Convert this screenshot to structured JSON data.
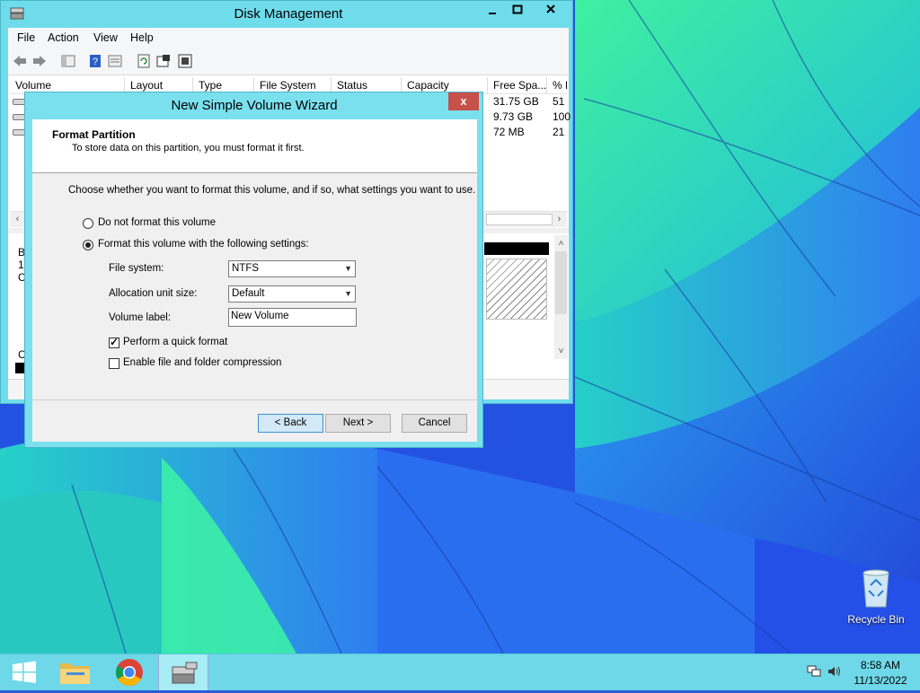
{
  "colors": {
    "window_frame": "#6fdcec",
    "close_button": "#c7504a",
    "taskbar": "#6fd8e8",
    "default_button_border": "#3c8fd9"
  },
  "disk_management": {
    "title": "Disk Management",
    "menu": [
      "File",
      "Action",
      "View",
      "Help"
    ],
    "toolbar_icons": [
      "back-arrow-icon",
      "forward-arrow-icon",
      "console-tree-icon",
      "help-icon",
      "properties-icon",
      "refresh-icon",
      "settings-icon",
      "rescan-icon"
    ],
    "columns": [
      "Volume",
      "Layout",
      "Type",
      "File System",
      "Status",
      "Capacity",
      "Free Spa...",
      "% F"
    ],
    "rows": [
      {
        "free": "31.75 GB",
        "pct": "51"
      },
      {
        "free": "9.73 GB",
        "pct": "100"
      },
      {
        "free": "72 MB",
        "pct": "21"
      }
    ],
    "disk_pane_letters": [
      "B",
      "1",
      "C",
      "C"
    ]
  },
  "wizard": {
    "title": "New Simple Volume Wizard",
    "close_glyph": "x",
    "step_title": "Format Partition",
    "step_desc": "To store data on this partition, you must format it first.",
    "instruction": "Choose whether you want to format this volume, and if so, what settings you want to use.",
    "radio_no_format": "Do not format this volume",
    "radio_format": "Format this volume with the following settings:",
    "file_system_label": "File system:",
    "file_system_value": "NTFS",
    "alloc_label": "Allocation unit size:",
    "alloc_value": "Default",
    "volume_label_label": "Volume label:",
    "volume_label_value": "New Volume",
    "quick_format_label": "Perform a quick format",
    "compression_label": "Enable file and folder compression",
    "back_label": "< Back",
    "next_label": "Next >",
    "cancel_label": "Cancel"
  },
  "desktop": {
    "recycle_bin_label": "Recycle Bin"
  },
  "taskbar": {
    "time": "8:58 AM",
    "date": "11/13/2022"
  }
}
